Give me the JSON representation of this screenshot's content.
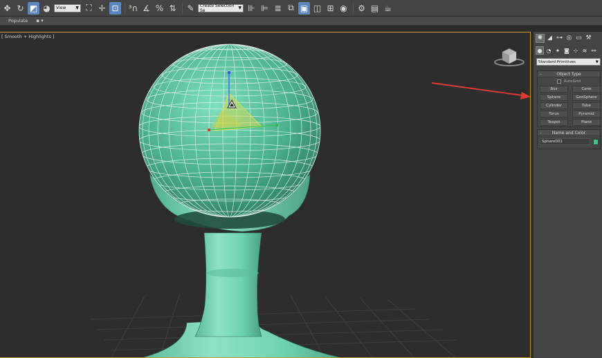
{
  "toolbar": {
    "reference_coord": "View",
    "selection_set": "Create Selection Se"
  },
  "ribbon": {
    "tab_populate": "Populate",
    "mini_icon": "▪ ▾"
  },
  "viewport": {
    "label": "[ Smooth + Highlights ]"
  },
  "command_panel": {
    "category": "Standard Primitives",
    "object_type_title": "Object Type",
    "autogrid_label": "AutoGrid",
    "buttons": [
      "Box",
      "Cone",
      "Sphere",
      "GeoSphere",
      "Cylinder",
      "Tube",
      "Torus",
      "Pyramid",
      "Teapot",
      "Plane"
    ],
    "name_color_title": "Name and Color",
    "object_name": "Sphere001",
    "object_color": "#3fc48f"
  },
  "colors": {
    "ui_bg": "#444444",
    "viewport_bg": "#2d2d2d",
    "viewport_border": "#c89a2a",
    "model": "#6fd3b0",
    "active_tool": "#5b87c0",
    "annotation_arrow": "#e03a2f"
  }
}
